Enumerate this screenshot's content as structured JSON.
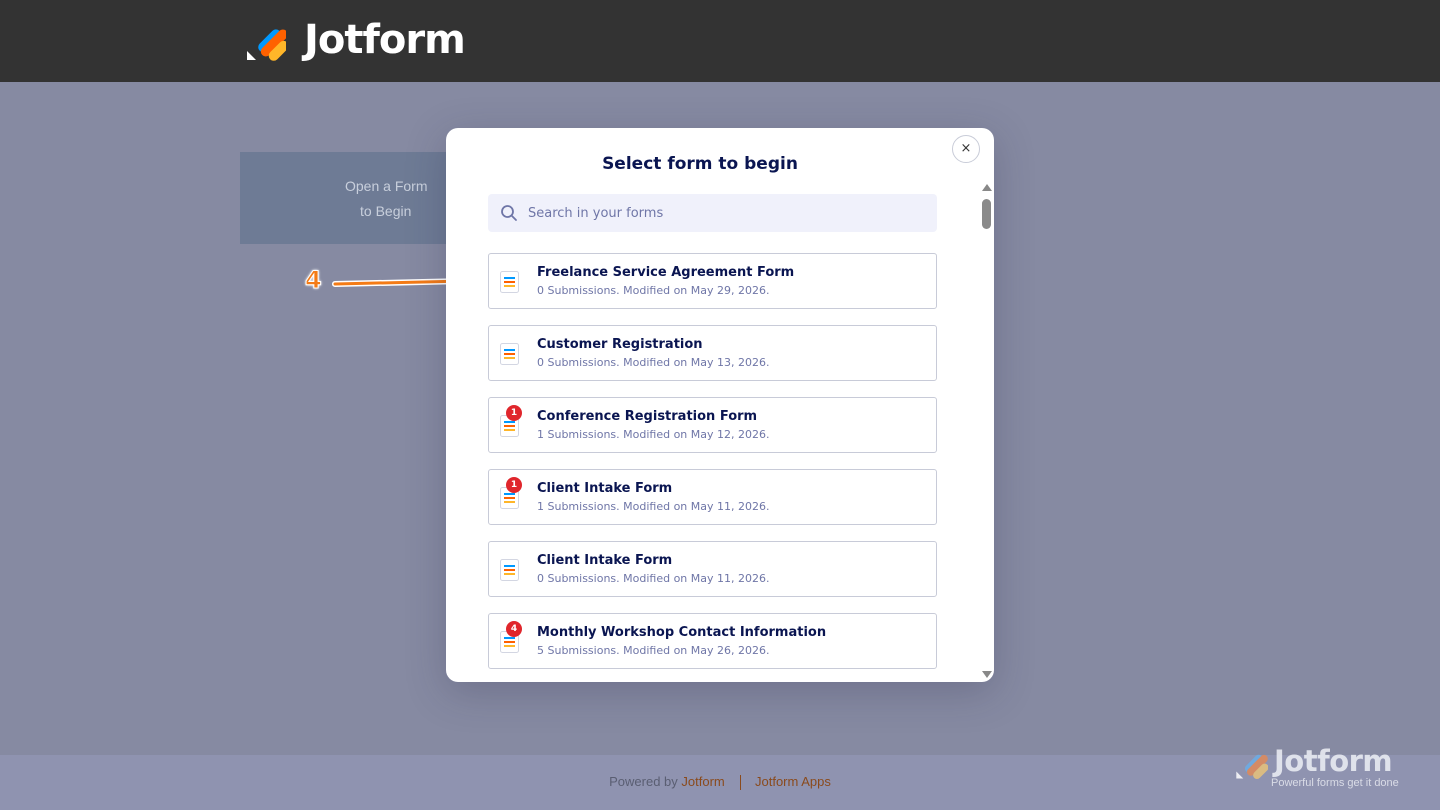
{
  "header": {
    "brand_name": "Jotform",
    "logo_icon": "jotform-logo-icon",
    "background_color": "#333333"
  },
  "background": {
    "card_line1": "Open a Form",
    "card_line2": "to Begin"
  },
  "annotation": {
    "step_number": "4",
    "color": "#f47b16"
  },
  "modal": {
    "title": "Select form to begin",
    "close_label": "×",
    "search": {
      "placeholder": "Search in your forms",
      "value": ""
    },
    "forms": [
      {
        "title": "Freelance Service Agreement Form",
        "meta": "0 Submissions. Modified on May 29, 2026.",
        "badge": ""
      },
      {
        "title": "Customer Registration",
        "meta": "0 Submissions. Modified on May 13, 2026.",
        "badge": ""
      },
      {
        "title": "Conference Registration Form",
        "meta": "1 Submissions. Modified on May 12, 2026.",
        "badge": "1"
      },
      {
        "title": "Client Intake Form",
        "meta": "1 Submissions. Modified on May 11, 2026.",
        "badge": "1"
      },
      {
        "title": "Client Intake Form",
        "meta": "0 Submissions. Modified on May 11, 2026.",
        "badge": ""
      },
      {
        "title": "Monthly Workshop Contact Information",
        "meta": "5 Submissions. Modified on May 26, 2026.",
        "badge": "4"
      }
    ]
  },
  "footer": {
    "powered_by": "Powered by",
    "powered_brand": "Jotform",
    "apps_link": "Jotform Apps",
    "brand_name": "Jotform",
    "tagline": "Powerful forms get it done"
  },
  "colors": {
    "title_navy": "#0a1551",
    "meta_gray": "#6f76a7",
    "badge_red": "#e0262c",
    "accent_orange": "#ff6100",
    "accent_blue": "#0099ff",
    "accent_yellow": "#ffb629"
  }
}
